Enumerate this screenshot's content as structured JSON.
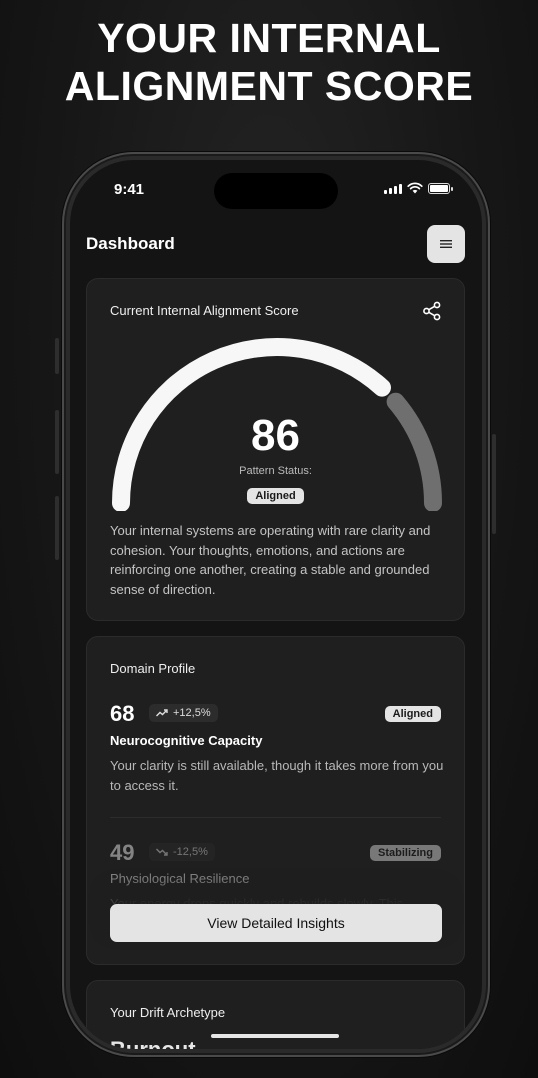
{
  "headline": [
    "YOUR INTERNAL",
    "ALIGNMENT SCORE"
  ],
  "status_bar": {
    "time": "9:41"
  },
  "header": {
    "title": "Dashboard",
    "menu_icon": "menu-icon"
  },
  "score_card": {
    "label": "Current Internal Alignment Score",
    "share_icon": "share-icon",
    "score": "86",
    "gauge_fraction": 0.86,
    "pattern_label": "Pattern Status:",
    "pattern_value": "Aligned",
    "description": "Your internal systems are operating with rare clarity and  cohesion. Your thoughts, emotions, and actions are reinforcing one  another, creating a stable and grounded sense of direction."
  },
  "domain_card": {
    "label": "Domain Profile",
    "domains": [
      {
        "score": "68",
        "delta": "+12,5%",
        "trend_icon": "trend-up-icon",
        "status": "Aligned",
        "name": "Neurocognitive Capacity",
        "text": "Your clarity is still available, though it takes more from you to access it."
      },
      {
        "score": "49",
        "delta": "-12,5%",
        "trend_icon": "trend-down-icon",
        "status": "Stabilizing",
        "name": "Physiological Resilience",
        "text": "Your energy drops quickly and rebuilds slowly. This"
      }
    ],
    "cta": "View Detailed Insights"
  },
  "archetype_card": {
    "label": "Your Drift Archetype",
    "title": "Burnout"
  },
  "colors": {
    "accent": "#e4e4e4",
    "background": "#141414",
    "card": "#1f1f1f"
  }
}
